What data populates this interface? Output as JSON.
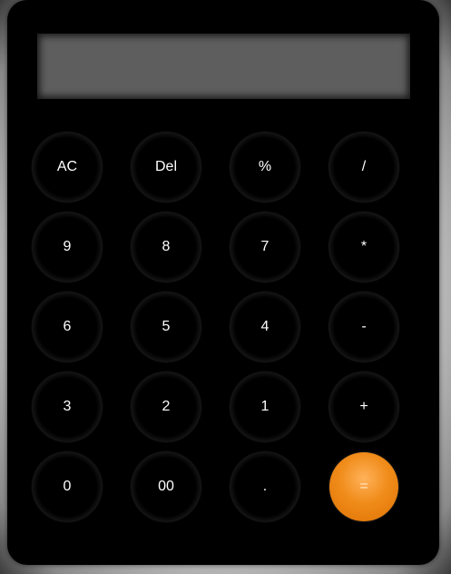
{
  "display": {
    "value": ""
  },
  "keys": [
    {
      "label": "AC",
      "name": "all-clear-button"
    },
    {
      "label": "Del",
      "name": "delete-button"
    },
    {
      "label": "%",
      "name": "percent-button"
    },
    {
      "label": "/",
      "name": "divide-button"
    },
    {
      "label": "9",
      "name": "digit-9-button"
    },
    {
      "label": "8",
      "name": "digit-8-button"
    },
    {
      "label": "7",
      "name": "digit-7-button"
    },
    {
      "label": "*",
      "name": "multiply-button"
    },
    {
      "label": "6",
      "name": "digit-6-button"
    },
    {
      "label": "5",
      "name": "digit-5-button"
    },
    {
      "label": "4",
      "name": "digit-4-button"
    },
    {
      "label": "-",
      "name": "subtract-button"
    },
    {
      "label": "3",
      "name": "digit-3-button"
    },
    {
      "label": "2",
      "name": "digit-2-button"
    },
    {
      "label": "1",
      "name": "digit-1-button"
    },
    {
      "label": "+",
      "name": "add-button"
    },
    {
      "label": "0",
      "name": "digit-0-button"
    },
    {
      "label": "00",
      "name": "double-zero-button"
    },
    {
      "label": ".",
      "name": "decimal-point-button"
    },
    {
      "label": "=",
      "name": "equals-button"
    }
  ],
  "colors": {
    "accent": "#f08c1a",
    "body": "#000000",
    "display": "#5e5e5e"
  }
}
